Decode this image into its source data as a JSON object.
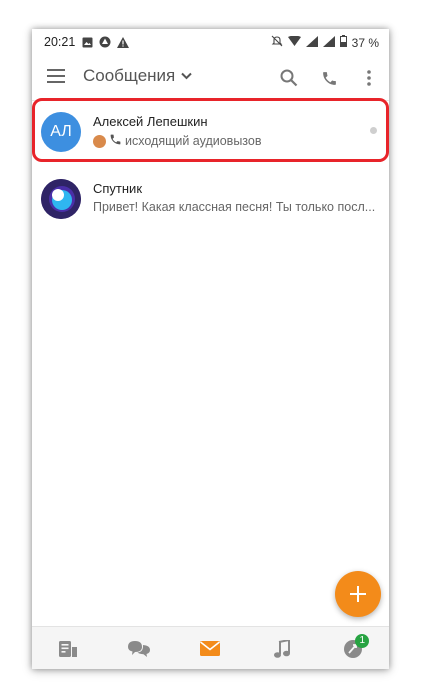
{
  "status_bar": {
    "time": "20:21",
    "battery": "37 %",
    "icons": [
      "image-icon",
      "drive-icon",
      "warning-icon",
      "mute-icon",
      "wifi-icon",
      "signal-icon",
      "signal-icon",
      "battery-icon"
    ]
  },
  "toolbar": {
    "title": "Сообщения",
    "icons": [
      "menu-icon",
      "chevron-down-icon",
      "search-icon",
      "phone-icon",
      "more-icon"
    ]
  },
  "chats": [
    {
      "avatar_initials": "АЛ",
      "name": "Алексей Лепешкин",
      "message": "исходящий аудиовызов",
      "avatar_color": "#3d8fe0",
      "highlighted": true
    },
    {
      "avatar_initials": "",
      "name": "Спутник",
      "message": "Привет! Какая классная песня! Ты только посл...",
      "avatar_color": "#2f2466",
      "highlighted": false
    }
  ],
  "fab": {
    "icon": "plus-icon",
    "color": "#f38b1a"
  },
  "bottom_nav": {
    "items": [
      "feed-icon",
      "discussions-icon",
      "messages-icon",
      "music-icon",
      "notifications-icon"
    ],
    "active": "messages-icon",
    "notification_badge": "1"
  },
  "colors": {
    "accent": "#f38b1a",
    "highlight_border": "#e8242a",
    "badge": "#27a342"
  }
}
